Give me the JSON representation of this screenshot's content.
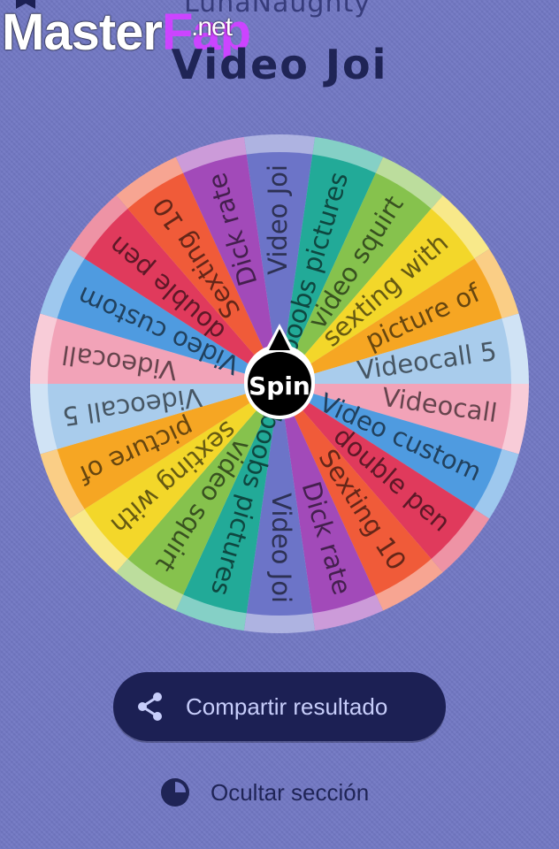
{
  "header": {
    "author": "LunaNaughty",
    "title": "Video Joi",
    "watermark": {
      "master": "Master",
      "fap": "Fap",
      "net": ".net"
    }
  },
  "wheel": {
    "center_label": "Spin",
    "segments": [
      {
        "label": "Video Joi",
        "color": "#6c74c8"
      },
      {
        "label": "boobs pictures",
        "color": "#22aa98"
      },
      {
        "label": "video squirt",
        "color": "#86c24d"
      },
      {
        "label": "sexting with",
        "color": "#f3d72a"
      },
      {
        "label": "picture of",
        "color": "#f6a623"
      },
      {
        "label": "Videocall 5",
        "color": "#a9ccec"
      },
      {
        "label": "Videocall",
        "color": "#f2a3b8"
      },
      {
        "label": "Video custom",
        "color": "#4f9be0"
      },
      {
        "label": "double pen",
        "color": "#e03a5c"
      },
      {
        "label": "Sexting 10",
        "color": "#f05b39"
      },
      {
        "label": "Dick rate",
        "color": "#a24ab9"
      },
      {
        "label": "Video Joi",
        "color": "#6c74c8"
      },
      {
        "label": "boobs pictures",
        "color": "#22aa98"
      },
      {
        "label": "video squirt",
        "color": "#86c24d"
      },
      {
        "label": "sexting with",
        "color": "#f3d72a"
      },
      {
        "label": "picture of",
        "color": "#f6a623"
      },
      {
        "label": "Videocall 5",
        "color": "#a9ccec"
      },
      {
        "label": "Videocall",
        "color": "#f2a3b8"
      },
      {
        "label": "Video custom",
        "color": "#4f9be0"
      },
      {
        "label": "double pen",
        "color": "#e03a5c"
      },
      {
        "label": "Sexting 10",
        "color": "#f05b39"
      },
      {
        "label": "Dick rate",
        "color": "#a24ab9"
      }
    ]
  },
  "actions": {
    "share_label": "Compartir resultado",
    "hide_label": "Ocultar sección"
  },
  "icons": {
    "share": "share-icon",
    "hide": "pie-chart-icon",
    "bookmark": "bookmark-icon"
  }
}
